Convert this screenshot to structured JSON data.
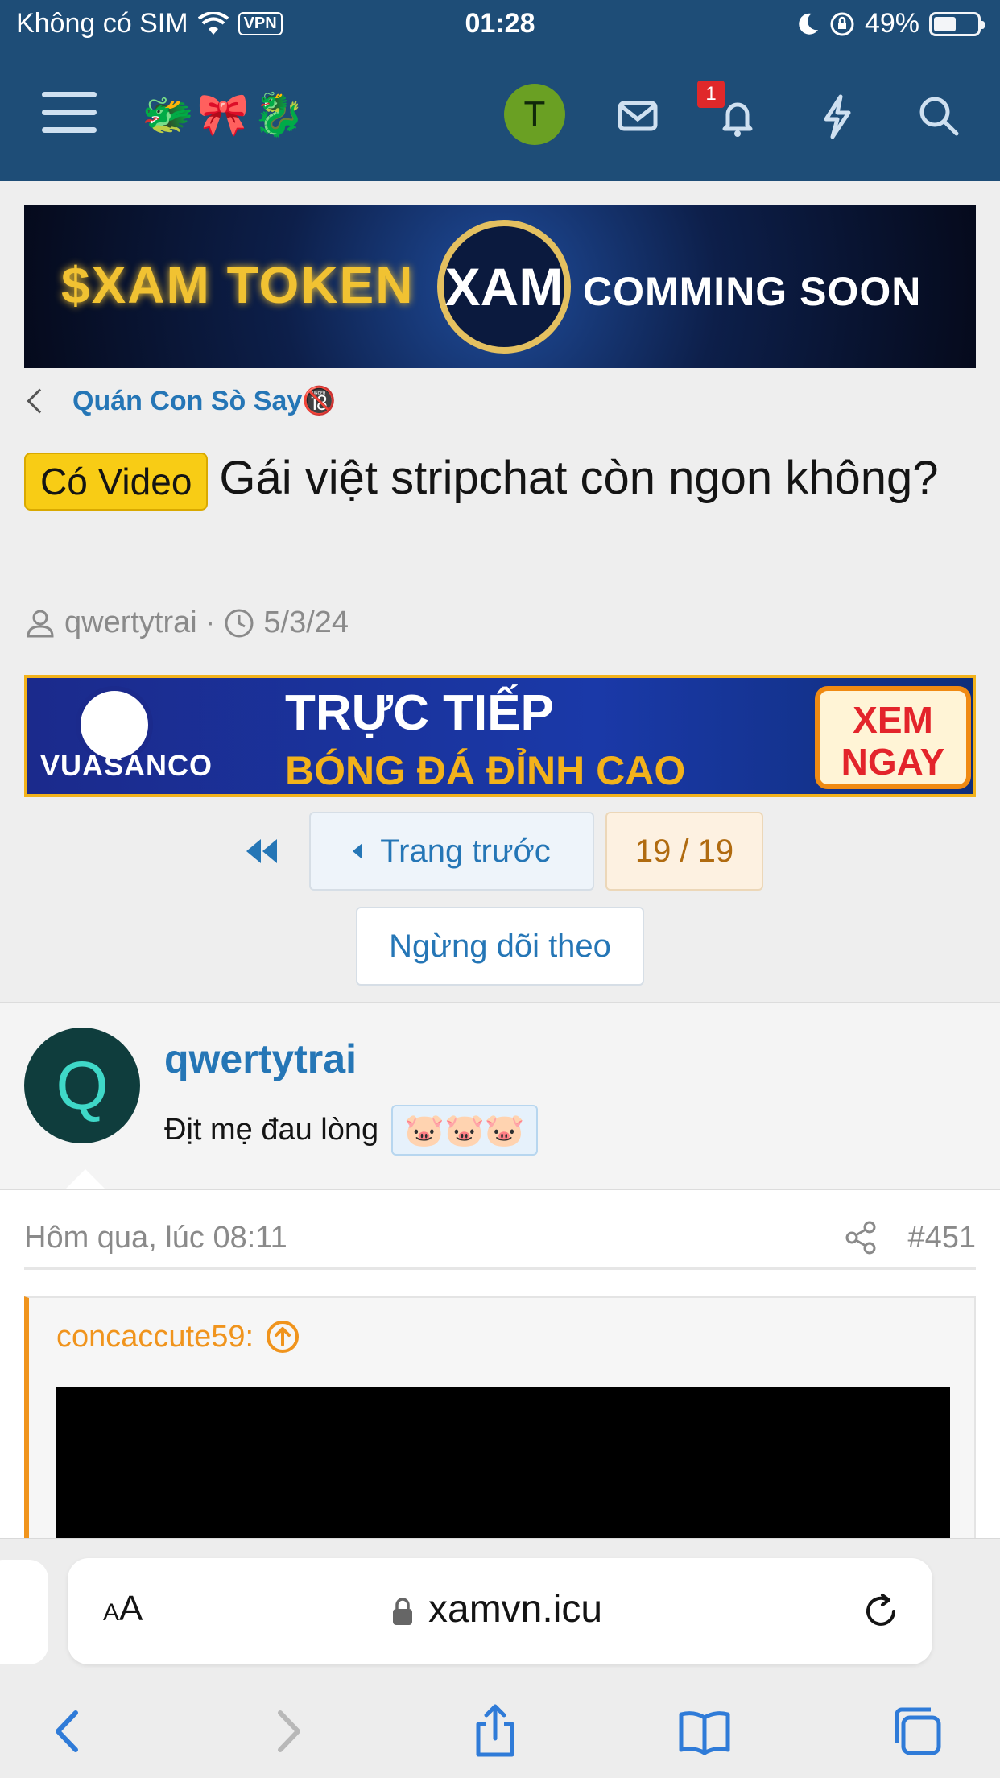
{
  "status_bar": {
    "carrier": "Không có SIM",
    "vpn": "VPN",
    "time": "01:28",
    "battery": "49%"
  },
  "header": {
    "logo_icons": [
      "🐲",
      "🎀",
      "🐉"
    ],
    "avatar_letter": "T",
    "notification_count": "1"
  },
  "banners": {
    "top": {
      "left_text": "$XAM TOKEN",
      "center_text": "XAM",
      "right_text": "COMMING SOON"
    },
    "second": {
      "brand": "VUASANCO",
      "line1": "TRỰC TIẾP",
      "line2": "BÓNG ĐÁ ĐỈNH CAO",
      "cta": "XEM NGAY"
    }
  },
  "breadcrumb": {
    "label": "Quán Con Sò Say",
    "emoji": "🔞"
  },
  "thread": {
    "prefix": "Có Video",
    "title": "Gái việt stripchat còn ngon không?",
    "author": "qwertytrai",
    "separator": "·",
    "date": "5/3/24"
  },
  "pagination": {
    "prev_label": "Trang trước",
    "page_indicator": "19 / 19"
  },
  "follow_button": "Ngừng dõi theo",
  "post": {
    "avatar_letter": "Q",
    "username": "qwertytrai",
    "user_title": "Địt mẹ đau lòng",
    "user_banner": "🐷🐷🐷",
    "date": "Hôm qua, lúc 08:11",
    "number": "#451",
    "quote_author": "concaccute59:"
  },
  "browser": {
    "text_size_label": "AA",
    "url": "xamvn.icu"
  },
  "colors": {
    "header_bg": "#1e4d77",
    "link": "#2576b6",
    "prefix_bg": "#f8cc15",
    "quote_accent": "#f0941d",
    "badge": "#e0282a"
  }
}
